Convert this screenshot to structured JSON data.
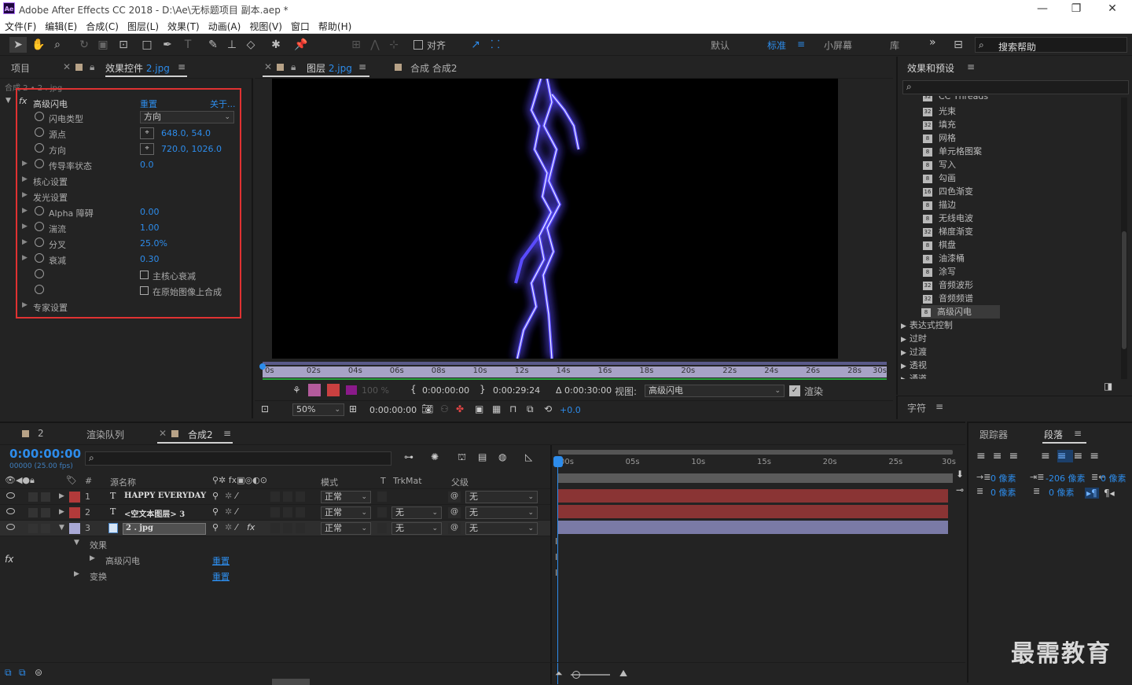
{
  "window": {
    "title": "Adobe After Effects CC 2018 - D:\\Ae\\无标题项目 副本.aep *",
    "logo": "Ae"
  },
  "menu": [
    "文件(F)",
    "编辑(E)",
    "合成(C)",
    "图层(L)",
    "效果(T)",
    "动画(A)",
    "视图(V)",
    "窗口",
    "帮助(H)"
  ],
  "toolbar": {
    "align_label": "对齐",
    "workspaces": [
      "默认",
      "标准",
      "小屏幕",
      "库"
    ],
    "active_workspace": "标准",
    "search_placeholder": "搜索帮助",
    "more": "»"
  },
  "effect_controls": {
    "tab_project": "项目",
    "tab_label": "效果控件",
    "tab_layer": "2.jpg",
    "breadcrumb": "合成 2 • 2 . jpg",
    "effect_name": "高级闪电",
    "reset": "重置",
    "about": "关于...",
    "params": [
      {
        "label": "闪电类型",
        "value": "方向",
        "kind": "dropdown"
      },
      {
        "label": "源点",
        "value": "648.0, 54.0",
        "kind": "point"
      },
      {
        "label": "方向",
        "value": "720.0, 1026.0",
        "kind": "point"
      },
      {
        "label": "传导率状态",
        "value": "0.0",
        "kind": "expand"
      },
      {
        "label": "核心设置",
        "value": "",
        "kind": "group"
      },
      {
        "label": "发光设置",
        "value": "",
        "kind": "group"
      },
      {
        "label": "Alpha 障碍",
        "value": "0.00",
        "kind": "expand"
      },
      {
        "label": "湍流",
        "value": "1.00",
        "kind": "expand"
      },
      {
        "label": "分叉",
        "value": "25.0%",
        "kind": "expand"
      },
      {
        "label": "衰减",
        "value": "0.30",
        "kind": "expand"
      },
      {
        "label": "主核心衰减",
        "value": "",
        "kind": "checkbox"
      },
      {
        "label": "在原始图像上合成",
        "value": "",
        "kind": "checkbox"
      },
      {
        "label": "专家设置",
        "value": "",
        "kind": "group"
      }
    ]
  },
  "viewer": {
    "tab_layer_label": "图层",
    "tab_layer_name": "2.jpg",
    "tab_comp": "合成 合成2",
    "ruler_ticks": [
      "0s",
      "02s",
      "04s",
      "06s",
      "08s",
      "10s",
      "12s",
      "14s",
      "16s",
      "18s",
      "20s",
      "22s",
      "24s",
      "26s",
      "28s",
      "30s"
    ],
    "opacity": "100 %",
    "in_time": "0:00:00:00",
    "out_time": "0:00:29:24",
    "duration": "Δ 0:00:30:00",
    "view_label": "视图:",
    "view_value": "高级闪电",
    "render_label": "渲染",
    "zoom": "50%",
    "timecode": "0:00:00:00",
    "exposure": "+0.0"
  },
  "effects_presets": {
    "title": "效果和预设",
    "search_placeholder": "",
    "items": [
      {
        "icon": "32",
        "label": "CC Threads"
      },
      {
        "icon": "32",
        "label": "光束"
      },
      {
        "icon": "32",
        "label": "填充"
      },
      {
        "icon": "8",
        "label": "网格"
      },
      {
        "icon": "8",
        "label": "单元格图案"
      },
      {
        "icon": "8",
        "label": "写入"
      },
      {
        "icon": "8",
        "label": "勾画"
      },
      {
        "icon": "16",
        "label": "四色渐变"
      },
      {
        "icon": "8",
        "label": "描边"
      },
      {
        "icon": "8",
        "label": "无线电波"
      },
      {
        "icon": "32",
        "label": "梯度渐变"
      },
      {
        "icon": "8",
        "label": "棋盘"
      },
      {
        "icon": "8",
        "label": "油漆桶"
      },
      {
        "icon": "8",
        "label": "涂写"
      },
      {
        "icon": "32",
        "label": "音频波形"
      },
      {
        "icon": "32",
        "label": "音频频谱"
      },
      {
        "icon": "8",
        "label": "高级闪电"
      }
    ],
    "categories": [
      "表达式控制",
      "过时",
      "过渡",
      "透视",
      "通道"
    ]
  },
  "character_panel": {
    "title": "字符"
  },
  "timeline": {
    "tab1": "2",
    "tab2": "渲染队列",
    "tab3": "合成2",
    "timecode": "0:00:00:00",
    "fps": "00000 (25.00 fps)",
    "ruler_ticks": [
      "00s",
      "05s",
      "10s",
      "15s",
      "20s",
      "25s",
      "30s"
    ],
    "headers": {
      "num": "#",
      "source": "源名称",
      "mode": "模式",
      "t": "T",
      "trkmat": "TrkMat",
      "parent": "父级"
    },
    "layers": [
      {
        "num": "1",
        "type": "T",
        "name": "HAPPY EVERYDAY",
        "mode": "正常",
        "trkmat": "",
        "parent": "无",
        "color": "#b23a3a"
      },
      {
        "num": "2",
        "type": "T",
        "name": "<空文本图层> 3",
        "mode": "正常",
        "trkmat": "无",
        "parent": "无",
        "color": "#b23a3a"
      },
      {
        "num": "3",
        "type": "img",
        "name": "2 . jpg",
        "mode": "正常",
        "trkmat": "无",
        "parent": "无",
        "color": "#a9a9d6"
      }
    ],
    "sub_effects": "效果",
    "sub_effect_name": "高级闪电",
    "sub_transform": "变换",
    "reset": "重置"
  },
  "tracker": {
    "title": "跟踪器"
  },
  "paragraph": {
    "title": "段落",
    "indent_left": "0 像素",
    "indent_first": "-206 像素",
    "indent_right": "0 像素",
    "space_before": "0 像素",
    "space_after": "0 像素"
  },
  "watermark": "最需教育"
}
